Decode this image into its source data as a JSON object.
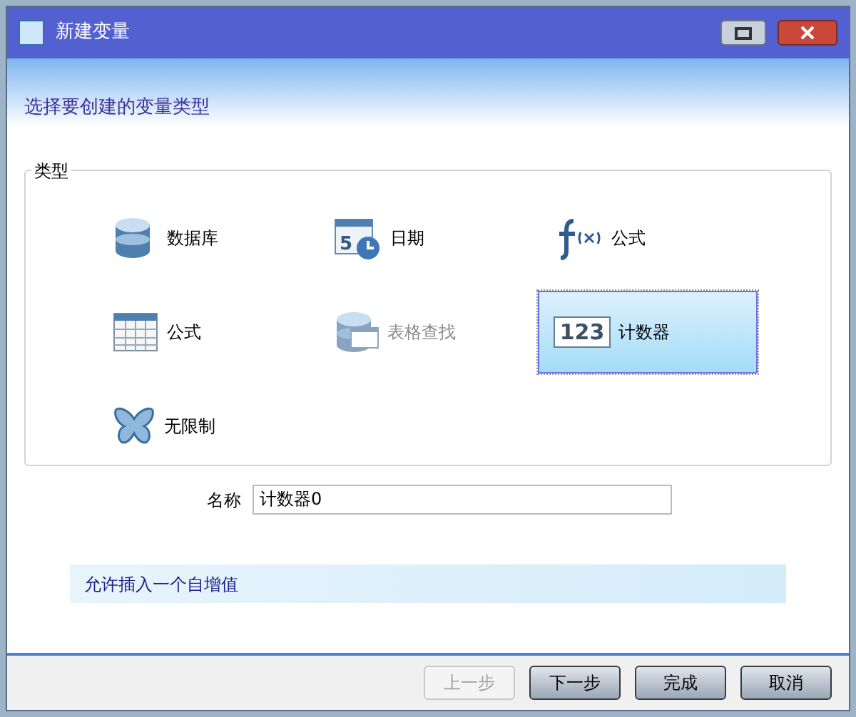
{
  "window": {
    "title": "新建变量"
  },
  "subtitle": "选择要创建的变量类型",
  "group": {
    "label": "类型",
    "items": [
      {
        "kind": "database",
        "label": "数据库",
        "selected": false,
        "disabled": false
      },
      {
        "kind": "calendar",
        "glyph": "5",
        "label": "日期",
        "selected": false,
        "disabled": false
      },
      {
        "kind": "function",
        "label": "公式",
        "selected": false,
        "disabled": false
      },
      {
        "kind": "table",
        "label": "公式",
        "selected": false,
        "disabled": false
      },
      {
        "kind": "lookup",
        "label": "表格查找",
        "selected": false,
        "disabled": true
      },
      {
        "kind": "counter",
        "glyph": "123",
        "label": "计数器",
        "selected": true,
        "disabled": false
      },
      {
        "kind": "butterfly",
        "label": "无限制",
        "selected": false,
        "disabled": false
      }
    ]
  },
  "name_field": {
    "label": "名称",
    "value": "计数器0"
  },
  "info": "允许插入一个自增值",
  "buttons": [
    {
      "label": "上一步",
      "disabled": true
    },
    {
      "label": "下一步",
      "disabled": false
    },
    {
      "label": "完成",
      "disabled": false
    },
    {
      "label": "取消",
      "disabled": false
    }
  ]
}
